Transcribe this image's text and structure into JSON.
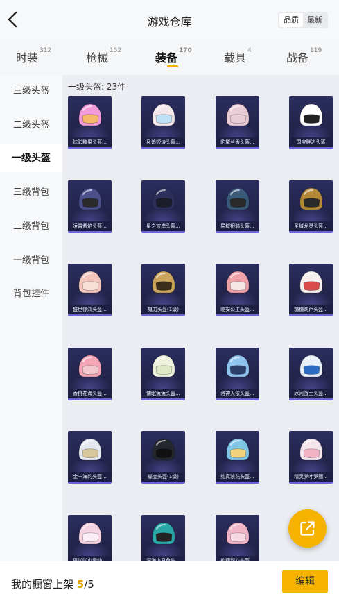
{
  "header": {
    "title": "游戏仓库",
    "sort_options": [
      "品质",
      "最新"
    ],
    "sort_active": 0
  },
  "tabs": [
    {
      "label": "时装",
      "count": "312"
    },
    {
      "label": "枪械",
      "count": "152"
    },
    {
      "label": "装备",
      "count": "170"
    },
    {
      "label": "载具",
      "count": "4"
    },
    {
      "label": "战备",
      "count": "119"
    }
  ],
  "active_tab": 2,
  "accent_color": "#f5b300",
  "sidebar": {
    "items": [
      "三级头盔",
      "二级头盔",
      "一级头盔",
      "三级背包",
      "二级背包",
      "一级背包",
      "背包挂件"
    ],
    "active": 2
  },
  "section": {
    "title": "一级头盔: 23件"
  },
  "items": [
    {
      "name": "炫彩糖果头盔...",
      "color": "#f29ad8",
      "visor": "#f6b86a"
    },
    {
      "name": "风追短诗头盔...",
      "color": "#f3e6ea",
      "visor": "#bfe0f5"
    },
    {
      "name": "豹黛兰香头盔...",
      "color": "#e9ccd6",
      "visor": "#e9ccd6"
    },
    {
      "name": "国宝胖达头盔",
      "color": "#ffffff",
      "visor": "#222222"
    },
    {
      "name": "凌霄紫焰头盔...",
      "color": "#4b4f8a",
      "visor": "#2b2b2b"
    },
    {
      "name": "星之彼岸头盔...",
      "color": "#2c2f5a",
      "visor": "#1d1d2a"
    },
    {
      "name": "异域银骑头盔...",
      "color": "#3a5a7a",
      "visor": "#2a2a2a"
    },
    {
      "name": "圣域龙灵头盔...",
      "color": "#b48a3a",
      "visor": "#2a2a2a"
    },
    {
      "name": "盛世惊鸿头盔...",
      "color": "#f2c6bd",
      "visor": "#f7dfd6"
    },
    {
      "name": "鬼刀头盔(1级)",
      "color": "#c9a45a",
      "visor": "#3a2e1a"
    },
    {
      "name": "临安公主头盔...",
      "color": "#f0a2a8",
      "visor": "#f6e7e7"
    },
    {
      "name": "糖糖葫芦头盔...",
      "color": "#f5f0ee",
      "visor": "#d94a4a"
    },
    {
      "name": "香桃花海头盔...",
      "color": "#f4a6b6",
      "visor": "#f2c8cf"
    },
    {
      "name": "慵眠兔兔头盔...",
      "color": "#eef2dc",
      "visor": "#dfe8c6"
    },
    {
      "name": "洛神天依头盔...",
      "color": "#8fc4ee",
      "visor": "#2a3f6a"
    },
    {
      "name": "冰河战士头盔...",
      "color": "#e7eff8",
      "visor": "#2b6cc4"
    },
    {
      "name": "金丰海豹头盔...",
      "color": "#e6e9f0",
      "visor": "#d8c69c"
    },
    {
      "name": "蝶变头盔(1级)",
      "color": "#25272e",
      "visor": "#111111"
    },
    {
      "name": "纯真浪花头盔...",
      "color": "#7fc6e8",
      "visor": "#f2d27a"
    },
    {
      "name": "精灵梦叶罗丽...",
      "color": "#f5e6ee",
      "visor": "#f3b3c6"
    },
    {
      "name": "巴啦啦小魔仙...",
      "color": "#f6d3e2",
      "visor": "#fbeef4"
    },
    {
      "name": "深海小丑鱼头...",
      "color": "#2aa6a6",
      "visor": "#222222"
    },
    {
      "name": "软萌甜心头盔...",
      "color": "#f3b6c9",
      "visor": "#f6d8e2"
    }
  ],
  "bottom": {
    "showcase_label": "我的橱窗上架",
    "showcase_current": "5",
    "showcase_total": "/5",
    "edit_label": "编辑"
  },
  "icons": {
    "back": "chevron-left-icon",
    "share": "external-link-icon"
  }
}
